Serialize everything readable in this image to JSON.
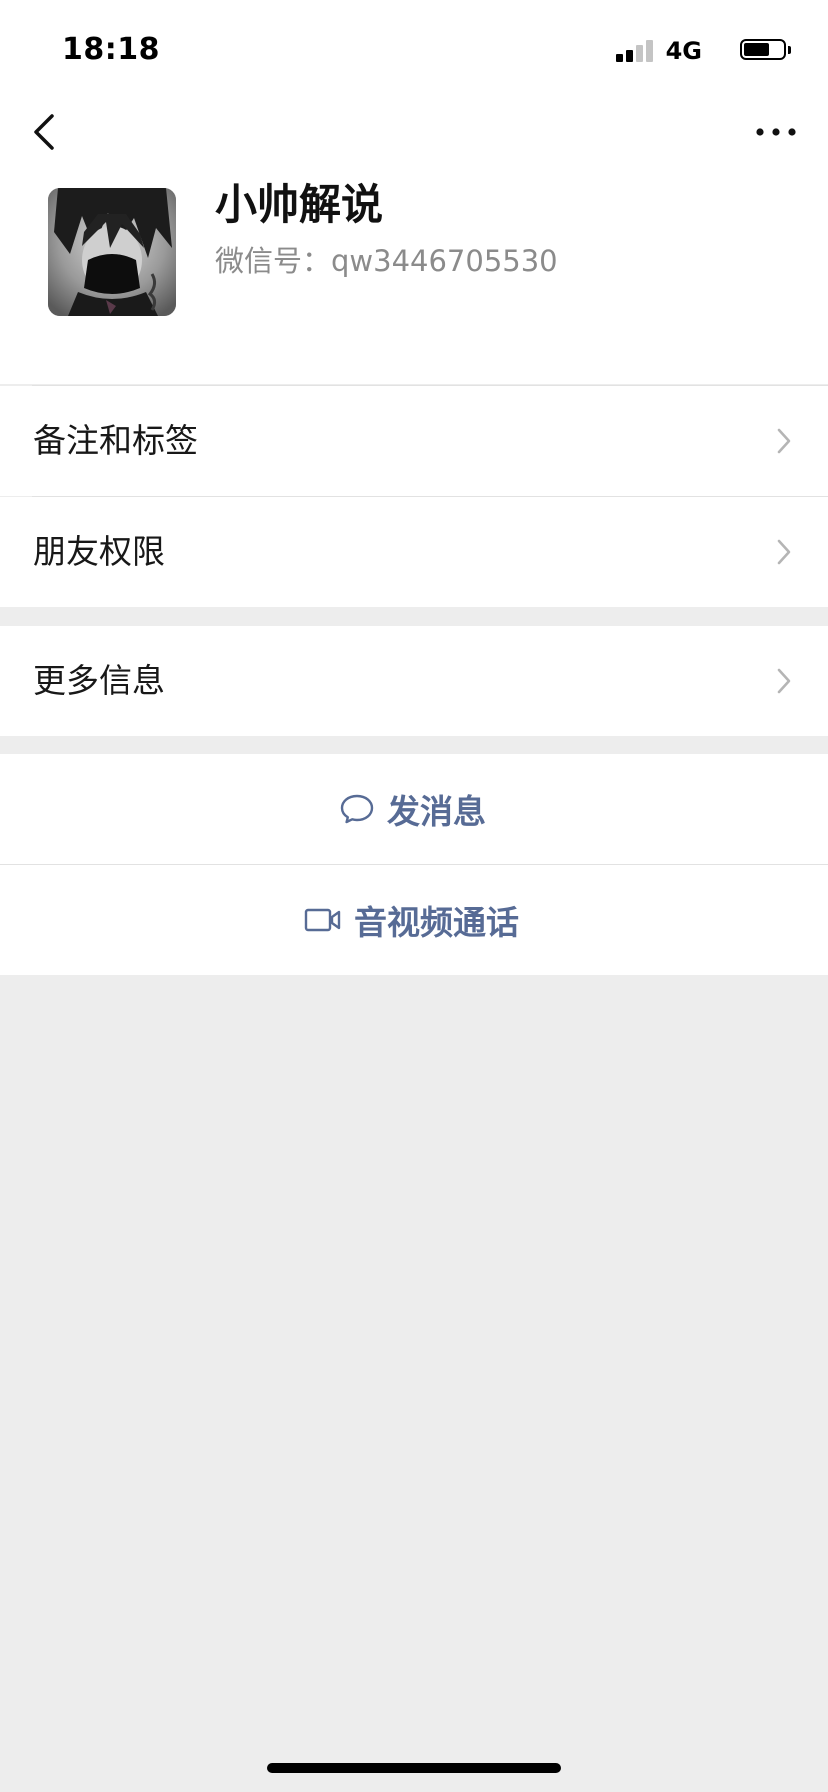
{
  "status_bar": {
    "time": "18:18",
    "network": "4G",
    "signal_bars_active": 2,
    "signal_bars_total": 4,
    "battery_level": 0.65
  },
  "nav": {
    "back_icon": "chevron-left-icon",
    "more_icon": "more-dots-icon"
  },
  "profile": {
    "name": "小帅解说",
    "wechat_id": "微信号：qw3446705530"
  },
  "menu": {
    "items": [
      {
        "label": "备注和标签"
      },
      {
        "label": "朋友权限"
      },
      {
        "label": "更多信息"
      }
    ]
  },
  "actions": {
    "send_message": "发消息",
    "av_call": "音视频通话"
  },
  "colors": {
    "page_bg": "#ededed",
    "card_bg": "#ffffff",
    "link_blue": "#576b95",
    "secondary_text": "#8b8b8b"
  }
}
